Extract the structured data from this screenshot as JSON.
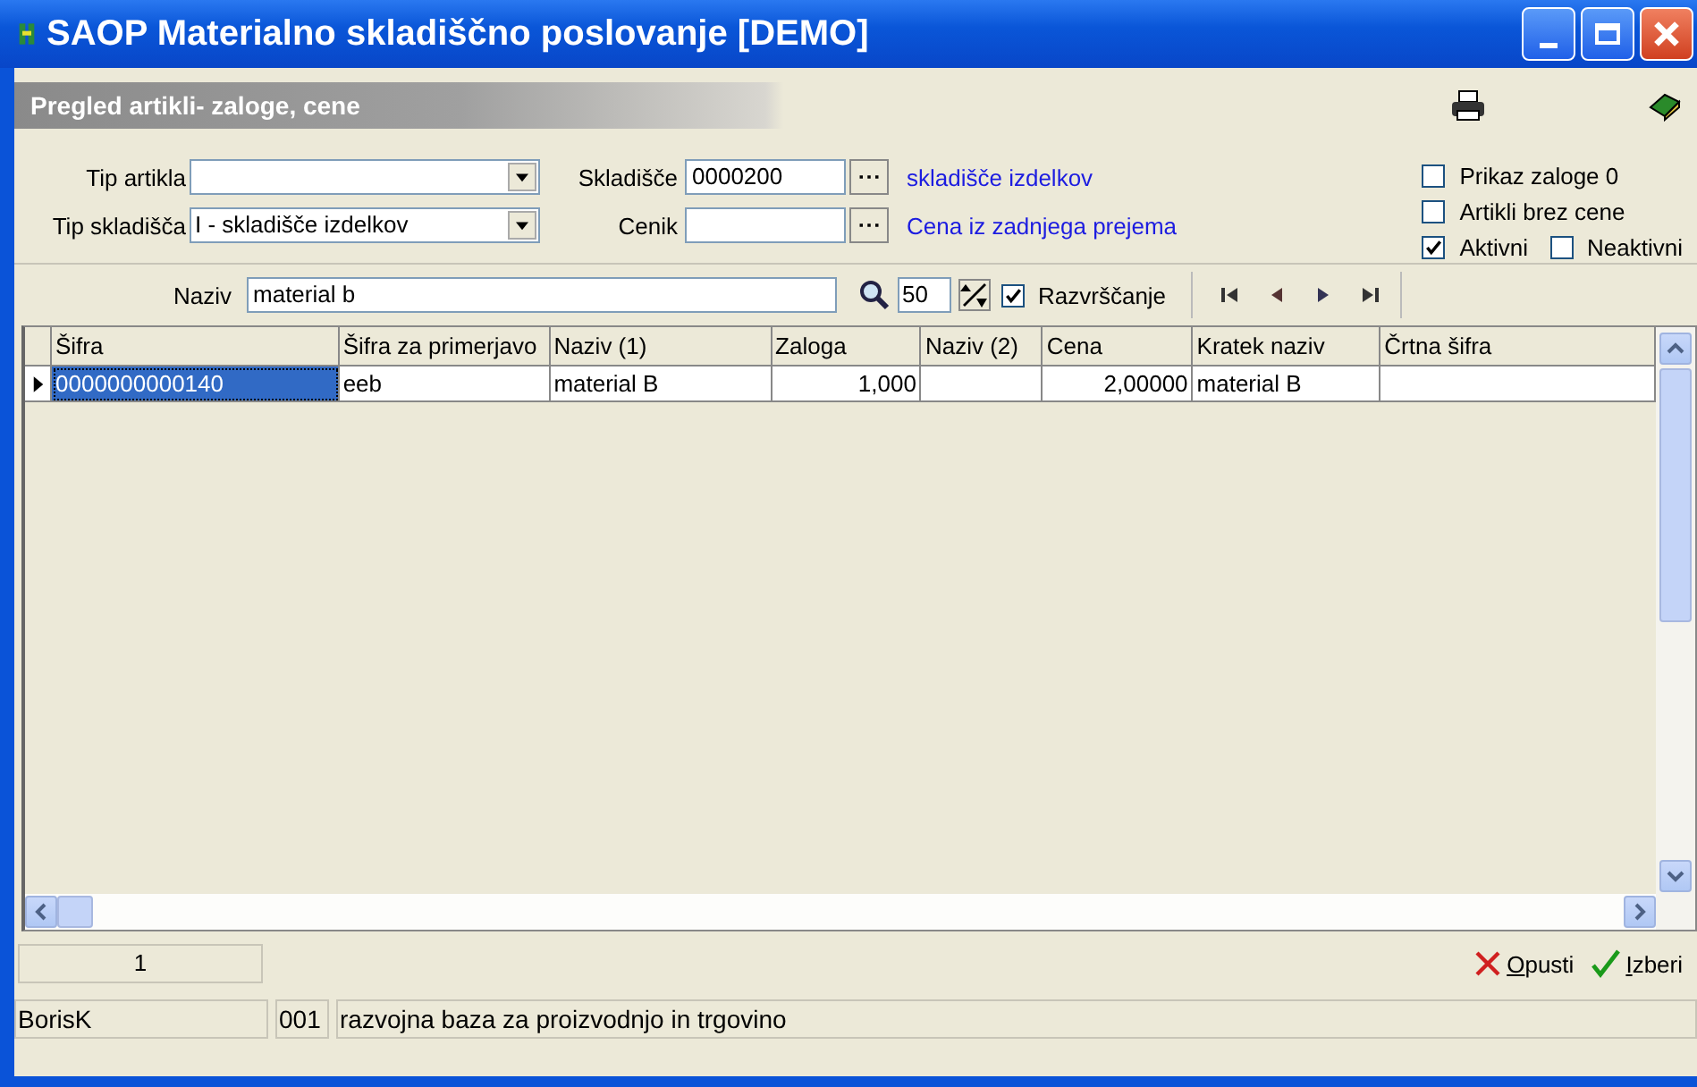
{
  "window": {
    "title": "SAOP Materialno skladiščno poslovanje [DEMO]"
  },
  "subheader": {
    "title": "Pregled artikli- zaloge, cene"
  },
  "filters": {
    "tip_artikla": {
      "label": "Tip artikla"
    },
    "tip_skladisca": {
      "label": "Tip skladišča",
      "value": "I - skladišče izdelkov"
    },
    "skladisce": {
      "label": "Skladišče",
      "value": "0000200",
      "description": "skladišče izdelkov"
    },
    "cenik": {
      "label": "Cenik",
      "description": "Cena iz zadnjega prejema"
    }
  },
  "options": [
    {
      "label": "Prikaz zaloge 0",
      "checked": false
    },
    {
      "label": "Artikli brez cene",
      "checked": false
    },
    {
      "label": "Aktivni",
      "checked": true
    },
    {
      "label": "Neaktivni",
      "checked": false
    }
  ],
  "search": {
    "label": "Naziv",
    "value": "material b",
    "count": "50",
    "sort": {
      "label": "Razvrščanje",
      "checked": true
    }
  },
  "table": {
    "columns": [
      "Šifra",
      "Šifra za primerjavo",
      "Naziv (1)",
      "Zaloga",
      "Naziv (2)",
      "Cena",
      "Kratek naziv",
      "Črtna šifra"
    ],
    "rows": [
      {
        "selected": true,
        "cells": [
          "0000000000140",
          "eeb",
          "material B",
          "1,000",
          "",
          "2,00000",
          "material B",
          ""
        ]
      }
    ]
  },
  "record_count": "1",
  "buttons": [
    {
      "kind": "cancel",
      "label": "Opusti"
    },
    {
      "kind": "ok",
      "label": "Izberi"
    }
  ],
  "status_bar": [
    "BorisK",
    "001",
    "razvojna baza za proizvodnjo in trgovino"
  ]
}
